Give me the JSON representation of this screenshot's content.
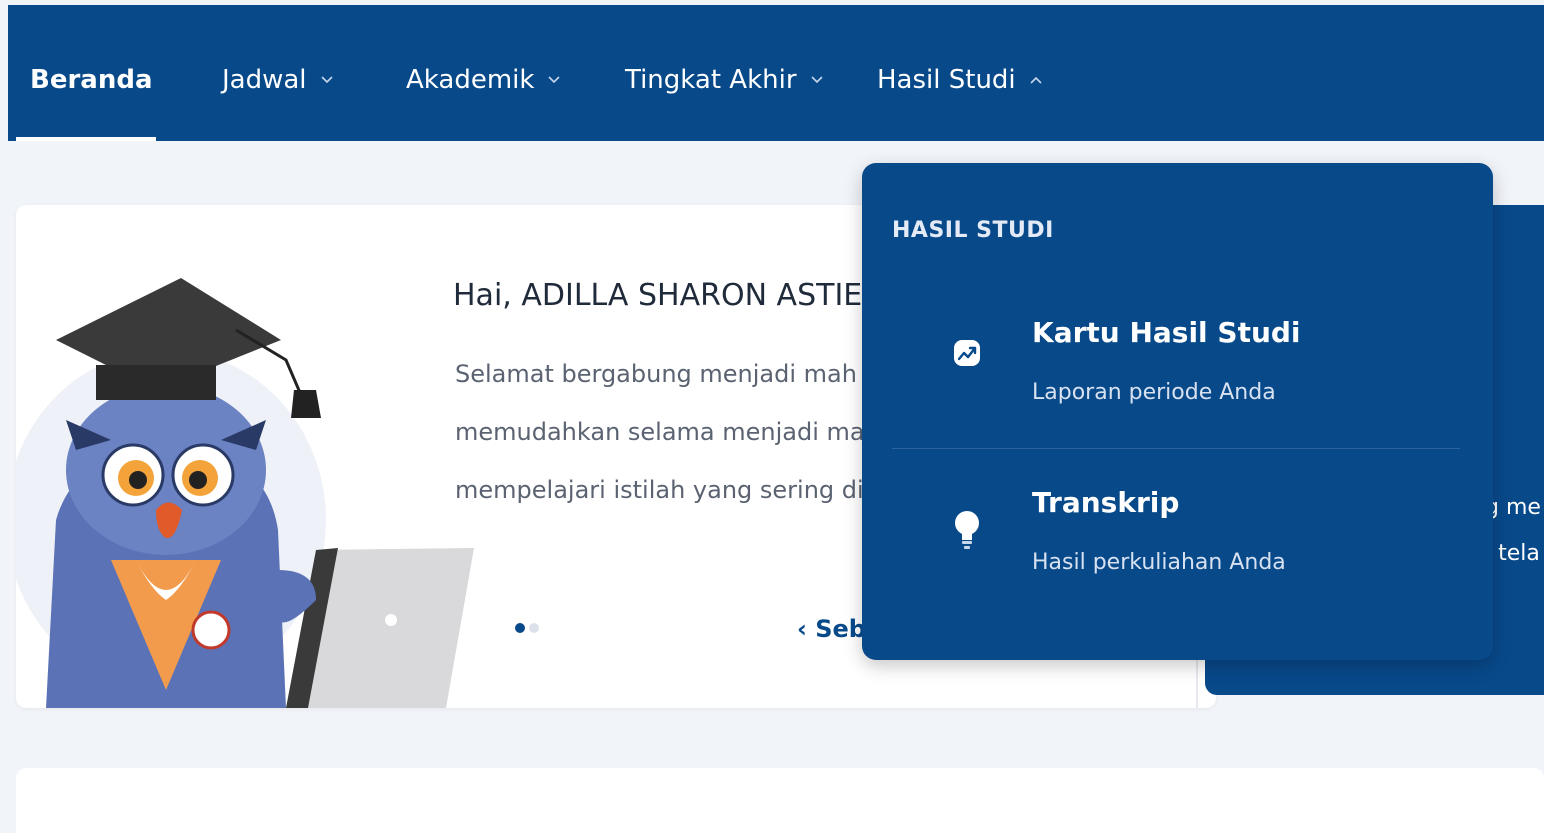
{
  "nav": {
    "items": [
      {
        "label": "Beranda",
        "active": true
      },
      {
        "label": "Jadwal"
      },
      {
        "label": "Akademik"
      },
      {
        "label": "Tingkat Akhir"
      },
      {
        "label": "Hasil Studi",
        "expanded": true
      }
    ]
  },
  "welcome": {
    "greeting": "Hai, ADILLA SHARON ASTIELY",
    "lines": [
      "Selamat bergabung menjadi mah",
      "memudahkan selama menjadi ma",
      "mempelajari istilah yang sering dig"
    ],
    "prev_label": "‹ Seb"
  },
  "right_card": {
    "lines": [
      "g me",
      "i tela"
    ]
  },
  "dropdown": {
    "header": "HASIL STUDI",
    "items": [
      {
        "title": "Kartu Hasil Studi",
        "subtitle": "Laporan periode Anda",
        "icon": "chart-trend-icon"
      },
      {
        "title": "Transkrip",
        "subtitle": "Hasil perkuliahan Anda",
        "icon": "lightbulb-icon"
      }
    ]
  },
  "colors": {
    "primary": "#08498a",
    "background": "#f1f4f9",
    "card": "#ffffff"
  }
}
